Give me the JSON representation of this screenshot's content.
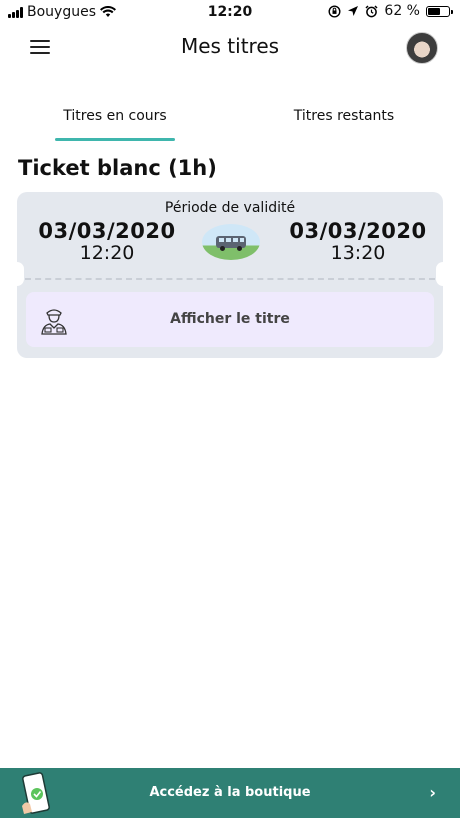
{
  "status_bar": {
    "carrier": "Bouygues",
    "time": "12:20",
    "battery": "62 %",
    "battery_level": 0.62
  },
  "header": {
    "title": "Mes titres"
  },
  "tabs": [
    {
      "label": "Titres en cours",
      "active": true
    },
    {
      "label": "Titres restants",
      "active": false
    }
  ],
  "ticket": {
    "title": "Ticket blanc (1h)",
    "validity_label": "Période de validité",
    "start_date": "03/03/2020",
    "start_time": "12:20",
    "end_date": "03/03/2020",
    "end_time": "13:20",
    "show_button_label": "Afficher le titre"
  },
  "bottom_bar": {
    "label": "Accédez à la boutique",
    "chevron": "›"
  },
  "colors": {
    "accent": "#3fb6ad",
    "bottom_bar": "#2f8074",
    "card": "#e4e8ee",
    "button": "#efeafd"
  }
}
